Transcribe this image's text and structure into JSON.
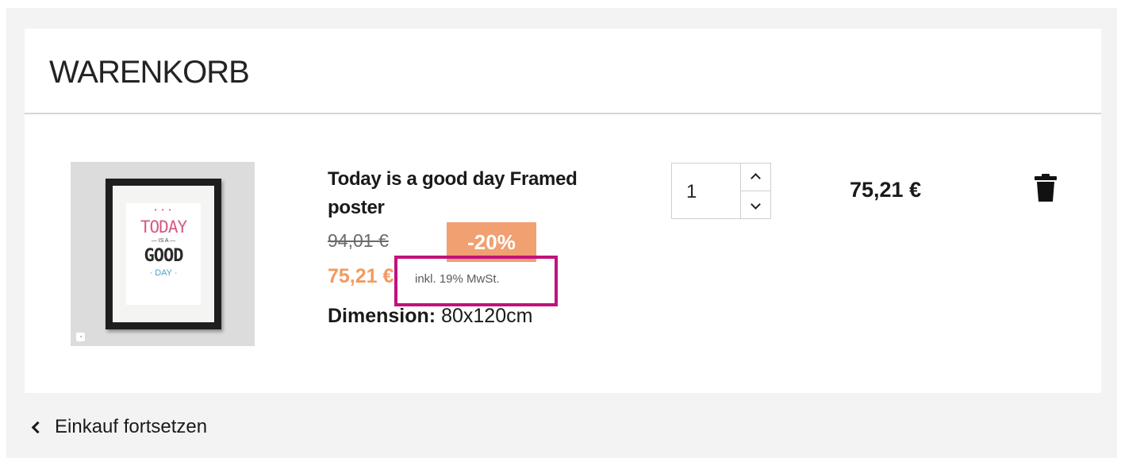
{
  "cart": {
    "title": "WARENKORB",
    "item": {
      "image_alt": "Today is a good day Framed poster",
      "poster_text": {
        "today": "TODAY",
        "is_a": "— IS A —",
        "good": "GOOD",
        "day": "· DAY ·"
      },
      "name": "Today is a good day Framed poster",
      "old_price": "94,01 €",
      "discount": "-20%",
      "price": "75,21 €",
      "tax_note": "inkl. 19% MwSt.",
      "dimension_label": "Dimension:",
      "dimension_value": "80x120cm",
      "quantity": "1",
      "line_total": "75,21 €"
    },
    "continue_label": "Einkauf fortsetzen"
  },
  "colors": {
    "discount_bg": "#f0a071",
    "price": "#f39a60",
    "highlight_border": "#c2127a"
  },
  "icons": {
    "quantity_up": "chevron-up-icon",
    "quantity_down": "chevron-down-icon",
    "delete": "trash-icon",
    "back": "chevron-left-icon"
  }
}
